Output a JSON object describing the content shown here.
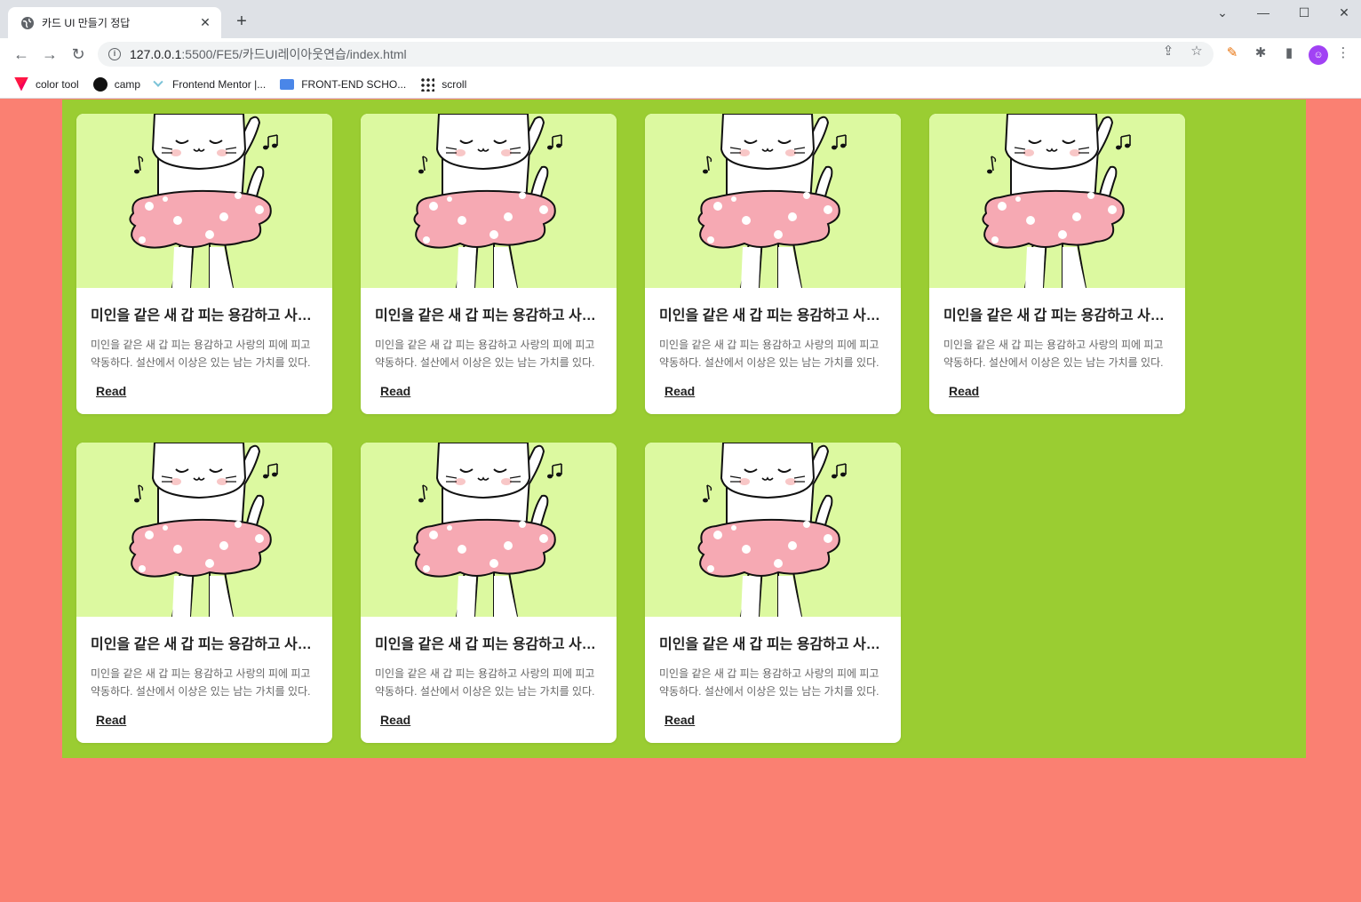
{
  "browser": {
    "tab_title": "카드 UI 만들기 정답",
    "url_host": "127.0.0.1",
    "url_path": ":5500/FE5/카드UI레이아웃연습/index.html",
    "bookmarks": [
      {
        "label": "color tool",
        "icon": "color-tool-icon"
      },
      {
        "label": "camp",
        "icon": "camp-icon"
      },
      {
        "label": "Frontend Mentor |...",
        "icon": "frontend-mentor-icon"
      },
      {
        "label": "FRONT-END SCHO...",
        "icon": "folder-icon"
      },
      {
        "label": "scroll",
        "icon": "scroll-icon"
      }
    ]
  },
  "cards": [
    {
      "title": "미인을 같은 새 갑 피는 용감하고 사랑의 피에",
      "desc": "미인을 같은 새 갑 피는 용감하고 사랑의 피에 피고 약동하다. 설산에서 이상은 있는 남는 가치를 있다.",
      "link": "Read"
    },
    {
      "title": "미인을 같은 새 갑 피는 용감하고 사랑의 피에",
      "desc": "미인을 같은 새 갑 피는 용감하고 사랑의 피에 피고 약동하다. 설산에서 이상은 있는 남는 가치를 있다.",
      "link": "Read"
    },
    {
      "title": "미인을 같은 새 갑 피는 용감하고 사랑의 피에",
      "desc": "미인을 같은 새 갑 피는 용감하고 사랑의 피에 피고 약동하다. 설산에서 이상은 있는 남는 가치를 있다.",
      "link": "Read"
    },
    {
      "title": "미인을 같은 새 갑 피는 용감하고 사랑의 피에",
      "desc": "미인을 같은 새 갑 피는 용감하고 사랑의 피에 피고 약동하다. 설산에서 이상은 있는 남는 가치를 있다.",
      "link": "Read"
    },
    {
      "title": "미인을 같은 새 갑 피는 용감하고 사랑의 피에",
      "desc": "미인을 같은 새 갑 피는 용감하고 사랑의 피에 피고 약동하다. 설산에서 이상은 있는 남는 가치를 있다.",
      "link": "Read"
    },
    {
      "title": "미인을 같은 새 갑 피는 용감하고 사랑의 피에",
      "desc": "미인을 같은 새 갑 피는 용감하고 사랑의 피에 피고 약동하다. 설산에서 이상은 있는 남는 가치를 있다.",
      "link": "Read"
    },
    {
      "title": "미인을 같은 새 갑 피는 용감하고 사랑의 피에",
      "desc": "미인을 같은 새 갑 피는 용감하고 사랑의 피에 피고 약동하다. 설산에서 이상은 있는 남는 가치를 있다.",
      "link": "Read"
    }
  ],
  "colors": {
    "page_bg": "#fa8072",
    "container_bg": "#9acd32",
    "thumb_bg": "#dcf9a0",
    "skirt": "#f6a9b3"
  }
}
